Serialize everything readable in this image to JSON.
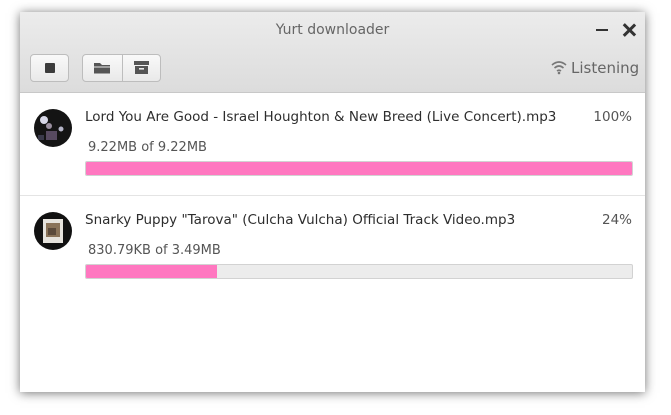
{
  "window": {
    "title": "Yurt downloader"
  },
  "toolbar": {
    "stop_icon": "stop-icon",
    "folder_icon": "folder-icon",
    "archive_icon": "archive-icon"
  },
  "status": {
    "text": "Listening",
    "icon": "wifi-icon"
  },
  "colors": {
    "progress_fill": "#ff77c0",
    "progress_track": "#ececec"
  },
  "downloads": [
    {
      "filename": "Lord You Are Good - Israel Houghton & New Breed (Live Concert).mp3",
      "percent": "100%",
      "progress": 1.0,
      "size": "9.22MB of 9.22MB"
    },
    {
      "filename": "Snarky Puppy \"Tarova\" (Culcha Vulcha) Official Track Video.mp3",
      "percent": "24%",
      "progress": 0.24,
      "size": "830.79KB of 3.49MB"
    }
  ]
}
